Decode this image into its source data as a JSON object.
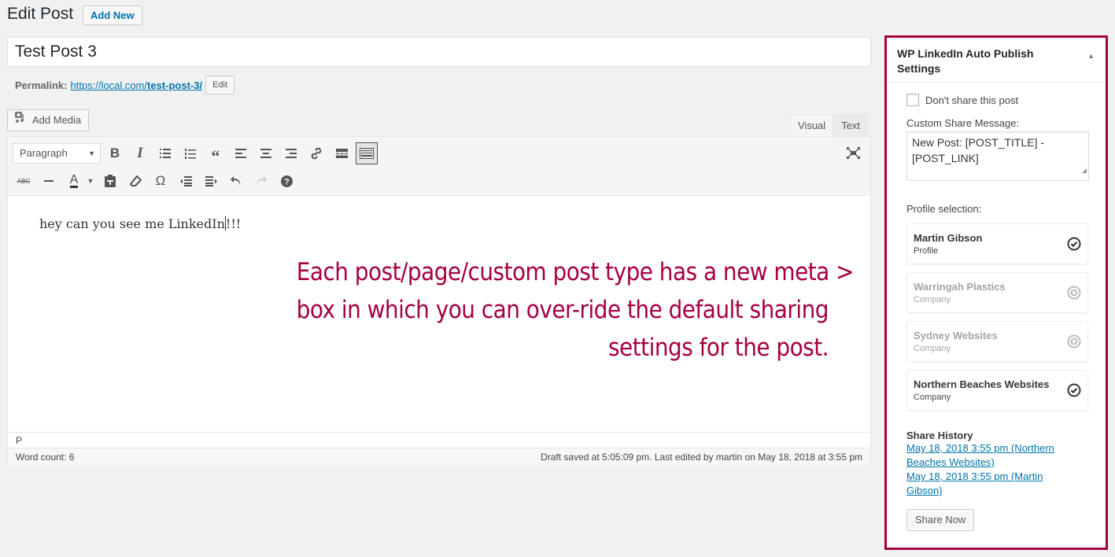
{
  "header": {
    "title": "Edit Post",
    "add_new_label": "Add New"
  },
  "post": {
    "title": "Test Post 3",
    "permalink_label": "Permalink:",
    "permalink_base": "https://local.com/",
    "permalink_slug": "test-post-3/",
    "permalink_edit_label": "Edit"
  },
  "editor": {
    "add_media_label": "Add Media",
    "tabs": [
      {
        "label": "Visual",
        "active": true
      },
      {
        "label": "Text",
        "active": false
      }
    ],
    "format_select": "Paragraph",
    "toolbar_row1": [
      "bold",
      "italic",
      "bulleted-list",
      "numbered-list",
      "blockquote",
      "align-left",
      "align-center",
      "align-right",
      "insert-link",
      "read-more",
      "toolbar-toggle"
    ],
    "toolbar_row2": [
      "strikethrough",
      "horizontal-line",
      "text-color",
      "paste-as-text",
      "clear-formatting",
      "special-character",
      "decrease-indent",
      "increase-indent",
      "undo",
      "redo",
      "keyboard-shortcuts"
    ],
    "content_before_cursor": "hey can you see me LinkedIn",
    "content_after_cursor": "!!!",
    "path": "P",
    "word_count": "Word count: 6",
    "save_status": "Draft saved at 5:05:09 pm. Last edited by martin on May 18, 2018 at 3:55 pm"
  },
  "annotation": {
    "line1": "Each post/page/custom post type has a new meta >",
    "line2": "box in which you can over-ride the default sharing",
    "line3": "settings for the post.",
    "color": "#a50040"
  },
  "metabox": {
    "title": "WP LinkedIn Auto Publish Settings",
    "dont_share_label": "Don't share this post",
    "dont_share_checked": false,
    "custom_message_label": "Custom Share Message:",
    "custom_message_value": "New Post: [POST_TITLE] - [POST_LINK]",
    "profile_selection_label": "Profile selection:",
    "profiles": [
      {
        "name": "Martin Gibson",
        "type": "Profile",
        "selected": true
      },
      {
        "name": "Warringah Plastics",
        "type": "Company",
        "selected": false
      },
      {
        "name": "Sydney Websites",
        "type": "Company",
        "selected": false
      },
      {
        "name": "Northern Beaches Websites",
        "type": "Company",
        "selected": true
      }
    ],
    "share_history_label": "Share History",
    "share_history": [
      "May 18, 2018 3:55 pm (Northern Beaches Websites)",
      "May 18, 2018 3:55 pm (Martin Gibson)"
    ],
    "share_now_label": "Share Now",
    "border_color": "#a50040"
  }
}
